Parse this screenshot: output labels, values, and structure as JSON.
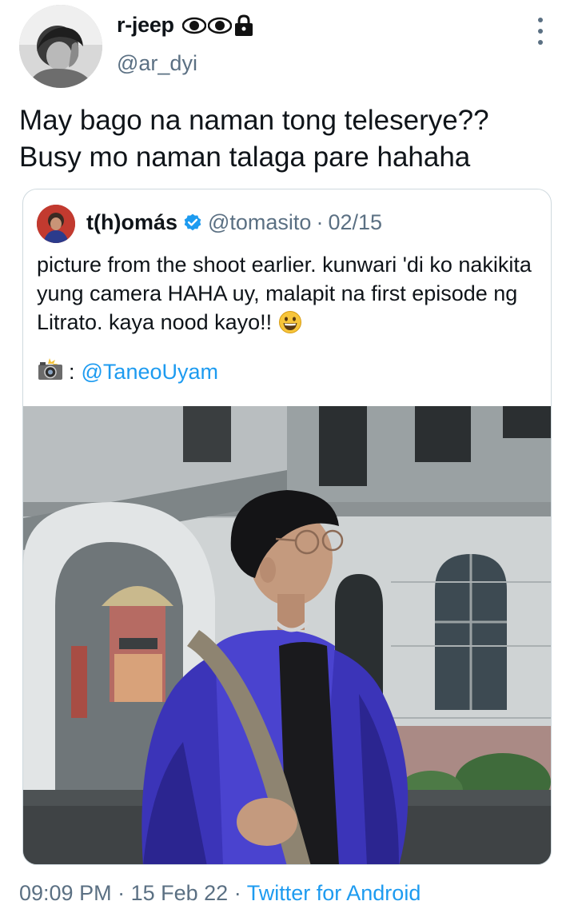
{
  "author": {
    "display_name": "r-jeep",
    "handle": "@ar_dyi",
    "avatar": "profile-photo",
    "badges": [
      "eye-emoji",
      "eye-emoji",
      "lock-icon"
    ]
  },
  "tweet": {
    "text": "May bago na naman tong teleserye??\nBusy mo naman talaga pare hahaha"
  },
  "quoted_tweet": {
    "display_name": "t(h)omás",
    "verified": true,
    "handle": "@tomasito",
    "separator": "·",
    "date": "02/15",
    "text": "picture from the shoot earlier. kunwari 'di ko nakikita yung camera HAHA uy, malapit na first episode ng Litrato. kaya nood kayo!!",
    "text_emoji": "grinning-face-emoji",
    "credit_icon": "camera-flash-emoji",
    "credit_separator": ":",
    "credit_mention": "@TaneoUyam",
    "photo": "person-in-blue-puffer-jacket-in-front-of-old-building"
  },
  "meta": {
    "time": "09:09 PM",
    "dot": "·",
    "date": "15 Feb 22",
    "source": "Twitter for Android"
  },
  "colors": {
    "text": "#0f1419",
    "secondary": "#5b7083",
    "link": "#1d9bf0",
    "border": "#cfd9de"
  }
}
